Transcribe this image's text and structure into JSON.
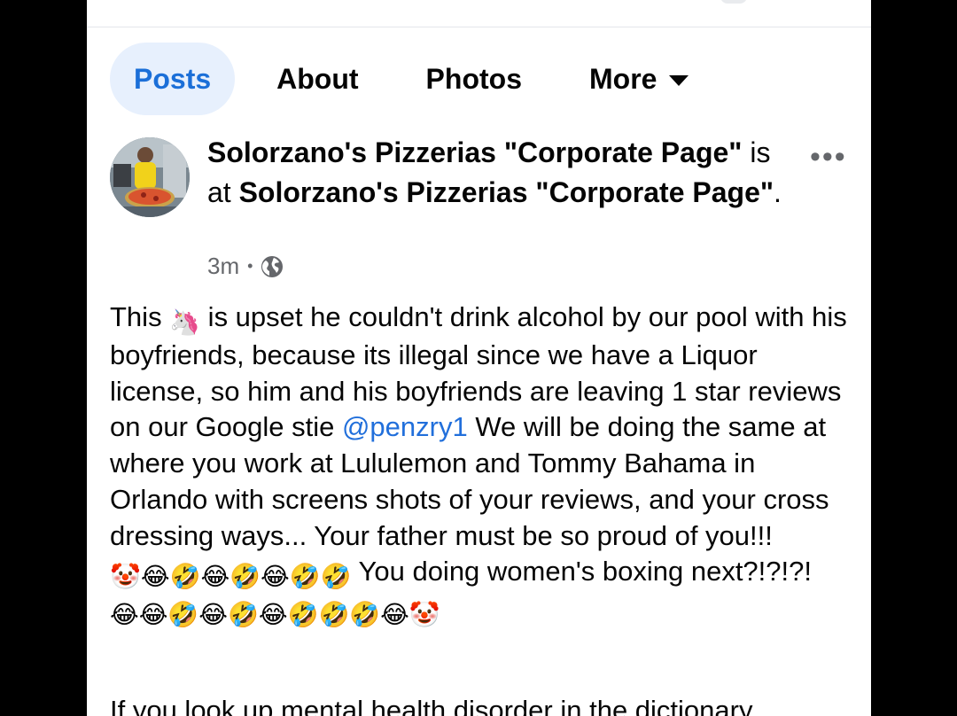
{
  "tabs": [
    {
      "label": "Posts",
      "active": true
    },
    {
      "label": "About"
    },
    {
      "label": "Photos"
    },
    {
      "label": "More"
    }
  ],
  "post": {
    "author": "Solorzano's Pizzerias \"Corporate Page\"",
    "at_prefix": " is at ",
    "location": "Solorzano's Pizzerias \"Corporate Page\"",
    "time": "3m",
    "privacy_icon": "globe-icon",
    "more_icon": "more-dots-icon",
    "body": {
      "t1": "This ",
      "e_unicorn": "🦄",
      "t2": " is upset he couldn't drink alcohol by our pool with his boyfriends, because its illegal since we have a Liquor license, so him and his boyfriends are leaving 1 star reviews on our Google stie ",
      "mention": "@penzry1",
      "t3": " We will be doing the same at where you work at Lululemon and Tommy Bahama in Orlando with screens shots of your reviews, and your cross dressing ways... Your father must be so proud of you!!! ",
      "emojis1": "🤡😂🤣😂🤣😂🤣🤣",
      "t4": " You doing women's boxing next?!?!?! ",
      "emojis2": "😂😂🤣😂🤣😂🤣🤣🤣😂🤡"
    },
    "para2": "If you look up mental health disorder in the dictionary"
  },
  "colors": {
    "accent": "#1b6fd8",
    "active_tab_bg": "#e7f0fd",
    "mention": "#216fdb",
    "muted": "#65676b"
  }
}
